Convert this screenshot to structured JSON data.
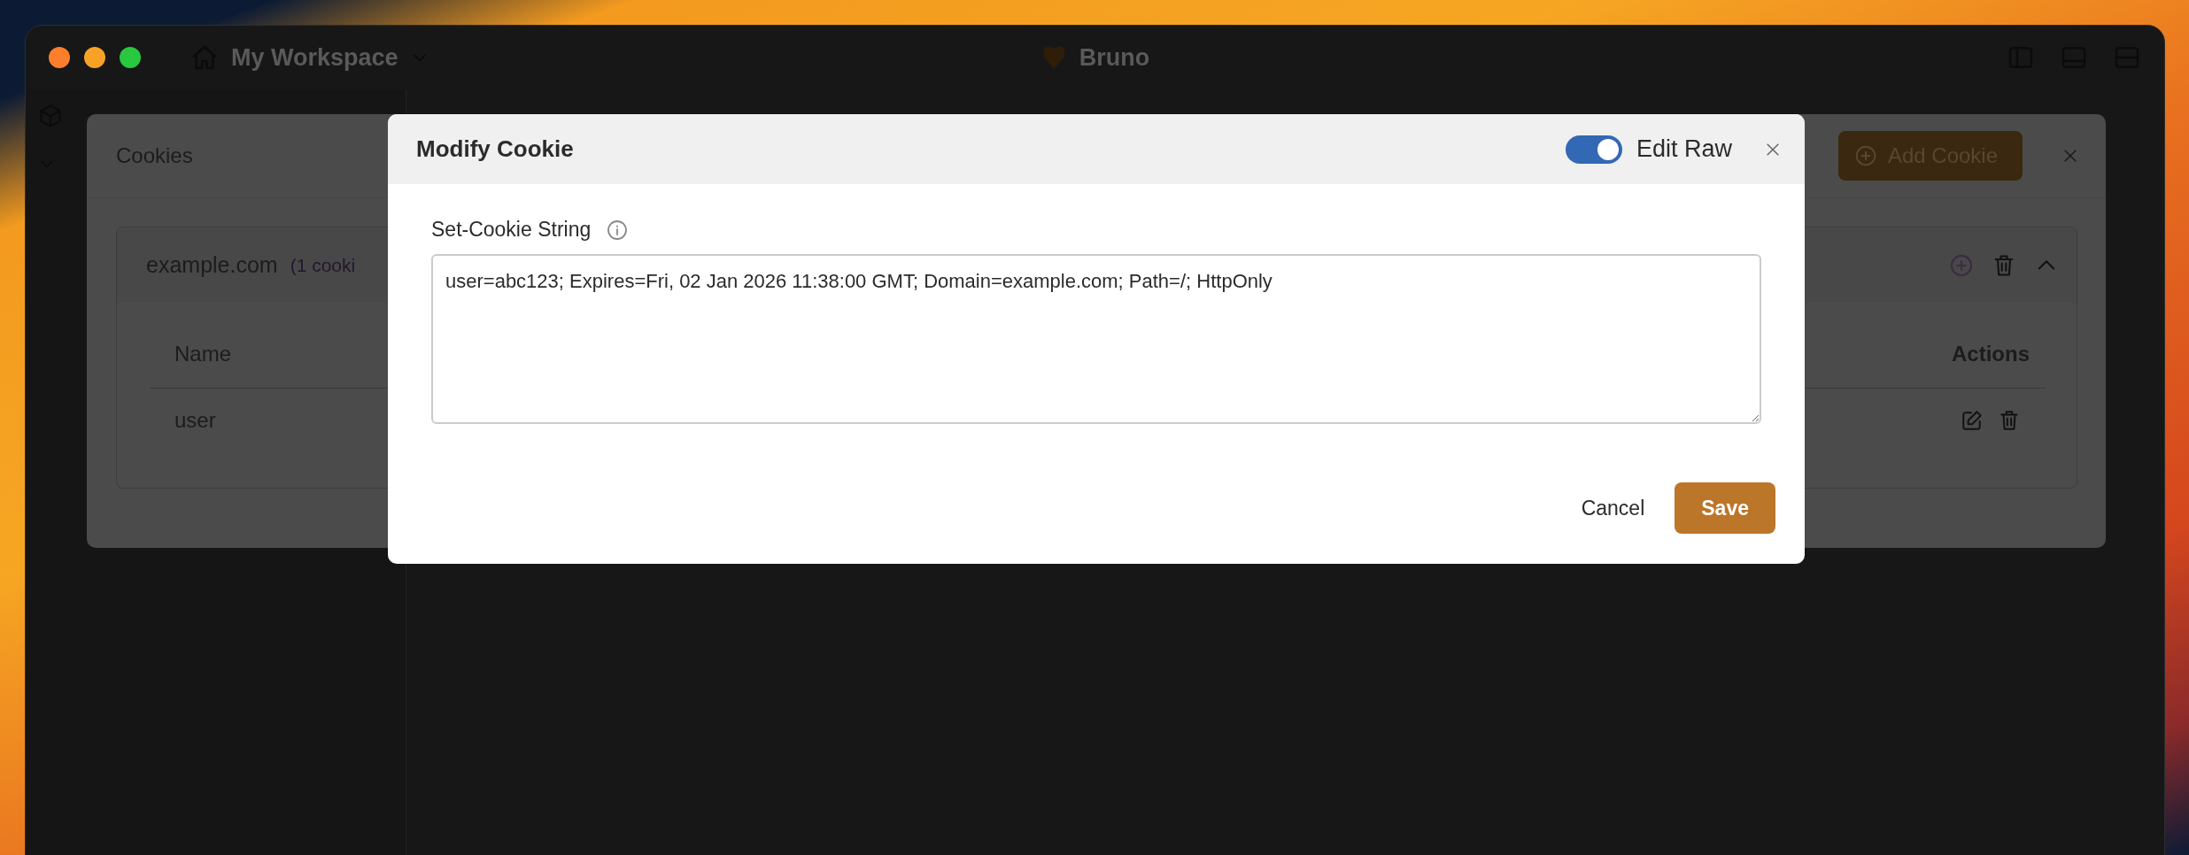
{
  "window": {
    "workspace": "My Workspace",
    "app_title": "Bruno"
  },
  "cookies_dialog": {
    "title": "Cookies",
    "add_button": "Add Cookie",
    "domains": [
      {
        "domain": "example.com",
        "count": "(1 cooki",
        "expanded": true,
        "columns": [
          "Name",
          "Actions"
        ],
        "rows": [
          {
            "name": "user"
          }
        ]
      }
    ]
  },
  "modify_dialog": {
    "title": "Modify Cookie",
    "edit_raw": {
      "label": "Edit Raw",
      "on": true
    },
    "field_label": "Set-Cookie String",
    "value": "user=abc123; Expires=Fri, 02 Jan 2026 11:38:00 GMT; Domain=example.com; Path=/; HttpOnly",
    "buttons": [
      {
        "label": "Cancel",
        "kind": "secondary"
      },
      {
        "label": "Save",
        "kind": "primary"
      }
    ]
  }
}
